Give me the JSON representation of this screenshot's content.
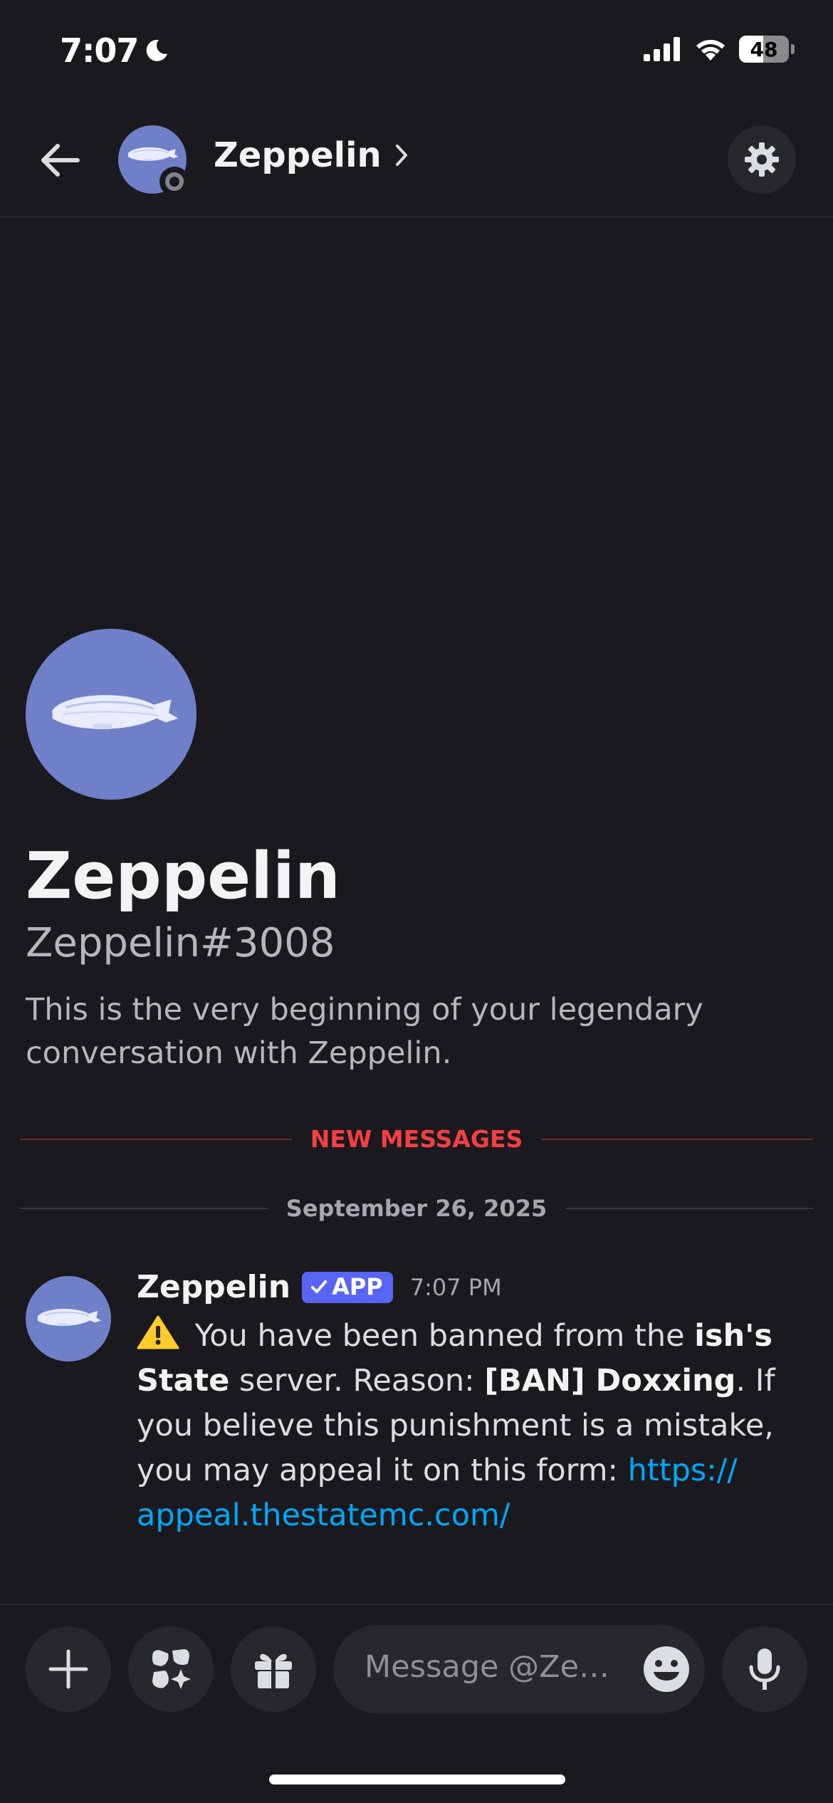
{
  "status_bar": {
    "time": "7:07",
    "battery": "48"
  },
  "header": {
    "title": "Zeppelin"
  },
  "profile": {
    "name": "Zeppelin",
    "tag": "Zeppelin#3008",
    "intro": "This is the very beginning of your legendary conversation with Zeppelin."
  },
  "dividers": {
    "new_messages": "NEW MESSAGES",
    "date": "September 26, 2025"
  },
  "message": {
    "author": "Zeppelin",
    "badge": "APP",
    "time": "7:07 PM",
    "text_1": " You have been banned from the ",
    "bold_server": "ish's State",
    "text_2": " server. Reason: ",
    "bold_reason": "[BAN] Doxxing",
    "text_3": ". If you believe this punishment is a mistake, you may appeal it on this form: ",
    "link": "https:// appeal.thestatemc.com/"
  },
  "composer": {
    "placeholder": "Message @Zeppelin"
  },
  "colors": {
    "background": "#1a1a1e",
    "accent": "#5865f2",
    "new_messages": "#f23f43",
    "link": "#00a8fc",
    "avatar": "#6f80c9"
  }
}
